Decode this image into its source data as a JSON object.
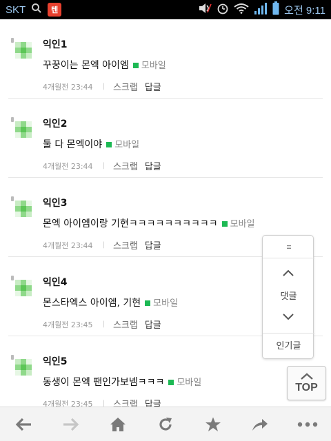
{
  "status_bar": {
    "carrier": "SKT",
    "time": "오전 9:11",
    "app_icon_text": "텐",
    "icons": [
      "search-icon",
      "app-badge-icon",
      "mute-icon",
      "alarm-icon",
      "wifi-icon",
      "signal-icon",
      "battery-icon"
    ],
    "accent": "#6fb7ee"
  },
  "comments": [
    {
      "nickname": "익인1",
      "text": "꾸꿍이는 몬엑 아이엠",
      "device": "모바일",
      "time": "4개월전 23:44",
      "scrap": "스크랩",
      "reply": "답글"
    },
    {
      "nickname": "익인2",
      "text": "둘 다 몬엑이야",
      "device": "모바일",
      "time": "4개월전 23:44",
      "scrap": "스크랩",
      "reply": "답글"
    },
    {
      "nickname": "익인3",
      "text": "몬엑 아이엠이랑 기현ㅋㅋㅋㅋㅋㅋㅋㅋㅋㅋ",
      "device": "모바일",
      "time": "4개월전 23:44",
      "scrap": "스크랩",
      "reply": "답글"
    },
    {
      "nickname": "익인4",
      "text": "몬스타엑스 아이엠, 기현",
      "device": "모바일",
      "time": "4개월전 23:45",
      "scrap": "스크랩",
      "reply": "답글"
    },
    {
      "nickname": "익인5",
      "text": "동생이 몬엑 팬인가보넴ㅋㅋㅋ",
      "device": "모바일",
      "time": "4개월전 23:45",
      "scrap": "스크랩",
      "reply": "답글"
    }
  ],
  "float_panel": {
    "comments_label": "댓글",
    "popular_label": "인기글"
  },
  "top_button": {
    "label": "TOP"
  },
  "toolbar": {
    "items": [
      "back-icon",
      "forward-icon",
      "home-icon",
      "refresh-icon",
      "bookmark-star-icon",
      "share-icon",
      "more-icon"
    ]
  },
  "colors": {
    "mobile_mark": "#1db954",
    "avatar_greens": [
      "#c8ecc4",
      "#8fd98a",
      "#5cc657",
      "#e6f7e4"
    ]
  }
}
